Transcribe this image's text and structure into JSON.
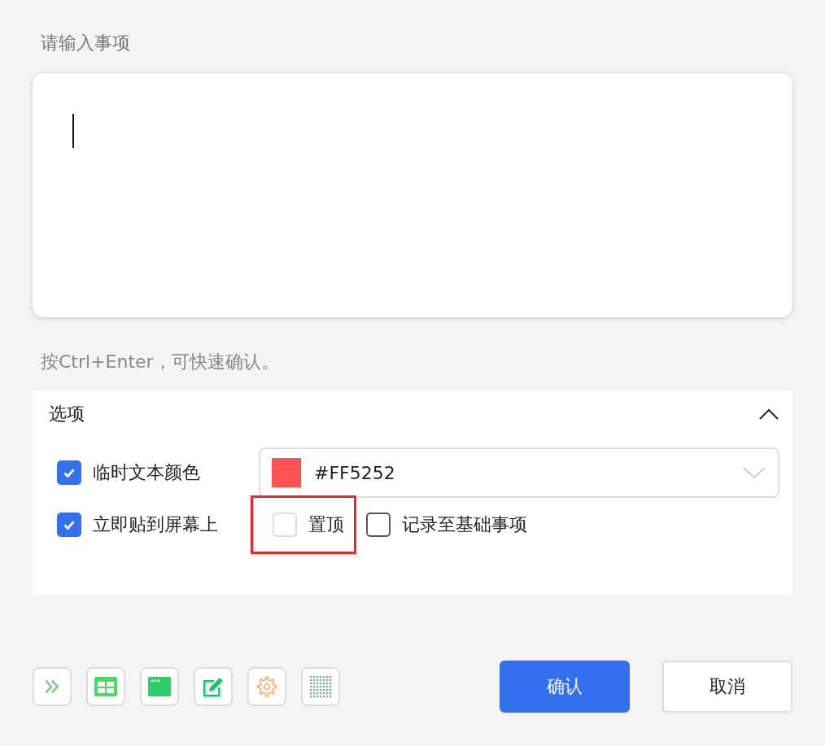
{
  "editor": {
    "label": "请输入事项",
    "focused": true
  },
  "hint": "按Ctrl+Enter，可快速确认。",
  "options": {
    "title": "选项",
    "expanded": true,
    "color_option": {
      "label": "临时文本颜色",
      "checked": true,
      "color": "#ff5252",
      "value": "#FF5252"
    },
    "checkboxes": [
      {
        "label": "立即贴到屏幕上",
        "checked": true,
        "disabled": false,
        "highlighted": false
      },
      {
        "label": "置顶",
        "checked": false,
        "disabled": true,
        "highlighted": true
      },
      {
        "label": "记录至基础事项",
        "checked": false,
        "disabled": false,
        "highlighted": false
      }
    ]
  },
  "buttons": [
    {
      "label": "确认",
      "primary": true
    },
    {
      "label": "取消",
      "primary": false
    }
  ]
}
